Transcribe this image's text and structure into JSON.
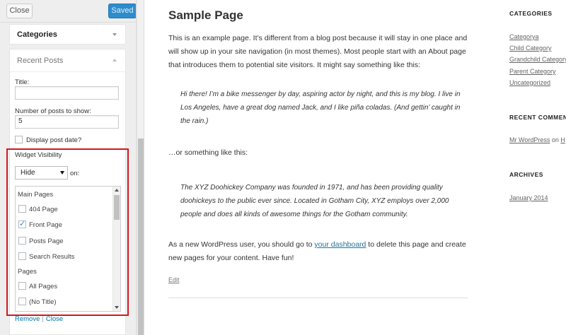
{
  "sidebar": {
    "close_label": "Close",
    "saved_label": "Saved",
    "categories_title": "Categories",
    "recent_title": "Recent Posts",
    "title_label": "Title:",
    "title_value": "",
    "count_label": "Number of posts to show:",
    "count_value": "5",
    "display_date_label": "Display post date?",
    "visibility_label": "Widget Visibility",
    "visibility_select": "Hide",
    "on_label": "on:",
    "list": {
      "main_pages_head": "Main Pages",
      "items_main": [
        {
          "label": "404 Page",
          "checked": false
        },
        {
          "label": "Front Page",
          "checked": true
        },
        {
          "label": "Posts Page",
          "checked": false
        },
        {
          "label": "Search Results",
          "checked": false
        }
      ],
      "pages_head": "Pages",
      "items_pages": [
        {
          "label": "All Pages",
          "checked": false
        },
        {
          "label": "(No Title)",
          "checked": false
        }
      ]
    },
    "remove_label": "Remove",
    "panel_close_label": "Close"
  },
  "content": {
    "title": "Sample Page",
    "intro": "This is an example page. It’s different from a blog post because it will stay in one place and will show up in your site navigation (in most themes). Most people start with an About page that introduces them to potential site visitors. It might say something like this:",
    "quote1": "Hi there! I’m a bike messenger by day, aspiring actor by night, and this is my blog. I live in Los Angeles, have a great dog named Jack, and I like piña coladas. (And gettin’ caught in the rain.)",
    "or_text": "…or something like this:",
    "quote2": "The XYZ Doohickey Company was founded in 1971, and has been providing quality doohickeys to the public ever since. Located in Gotham City, XYZ employs over 2,000 people and does all kinds of awesome things for the Gotham community.",
    "outro_pre": "As a new WordPress user, you should go to ",
    "outro_link": "your dashboard",
    "outro_post": " to delete this page and create new pages for your content. Have fun!",
    "edit": "Edit"
  },
  "widgets": {
    "categories_head": "CATEGORIES",
    "categories": [
      "Categorya",
      "Child Category",
      "Grandchild Category",
      "Parent Category",
      "Uncategorized"
    ],
    "comments_head": "RECENT COMMENTS",
    "comment_author": "Mr WordPress",
    "comment_on": " on ",
    "comment_target": "H",
    "archives_head": "ARCHIVES",
    "archives": [
      "January 2014"
    ]
  }
}
